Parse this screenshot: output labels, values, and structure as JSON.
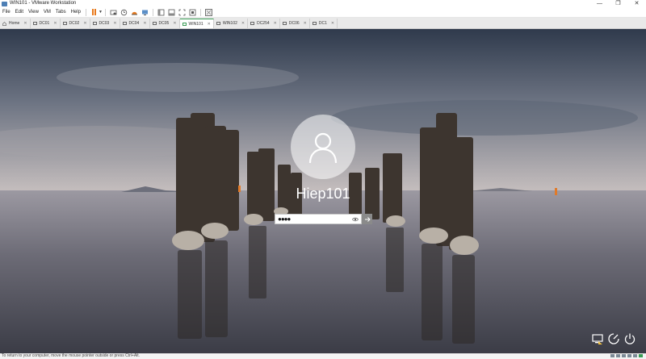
{
  "window": {
    "title": "WIN101 - VMware Workstation",
    "minimize": "—",
    "maximize": "❐",
    "close": "✕"
  },
  "menu": [
    "File",
    "Edit",
    "View",
    "VM",
    "Tabs",
    "Help"
  ],
  "tabs": [
    {
      "label": "Home",
      "active": false
    },
    {
      "label": "DC01",
      "active": false
    },
    {
      "label": "DC02",
      "active": false
    },
    {
      "label": "DC03",
      "active": false
    },
    {
      "label": "DC04",
      "active": false
    },
    {
      "label": "DC05",
      "active": false
    },
    {
      "label": "WIN101",
      "active": true
    },
    {
      "label": "WIN102",
      "active": false
    },
    {
      "label": "DC254",
      "active": false
    },
    {
      "label": "DC06",
      "active": false
    },
    {
      "label": "DC1",
      "active": false
    }
  ],
  "tab_close": "✕",
  "login": {
    "username": "Hiep101",
    "password_mask": "●●●●",
    "submit_icon": "arrow-right-icon",
    "reveal_icon": "eye-icon"
  },
  "status": {
    "text": "To return to your computer, move the mouse pointer outside or press Ctrl+Alt."
  },
  "colors": {
    "accent_green": "#3a9c55",
    "pause_orange": "#e87a1e"
  }
}
